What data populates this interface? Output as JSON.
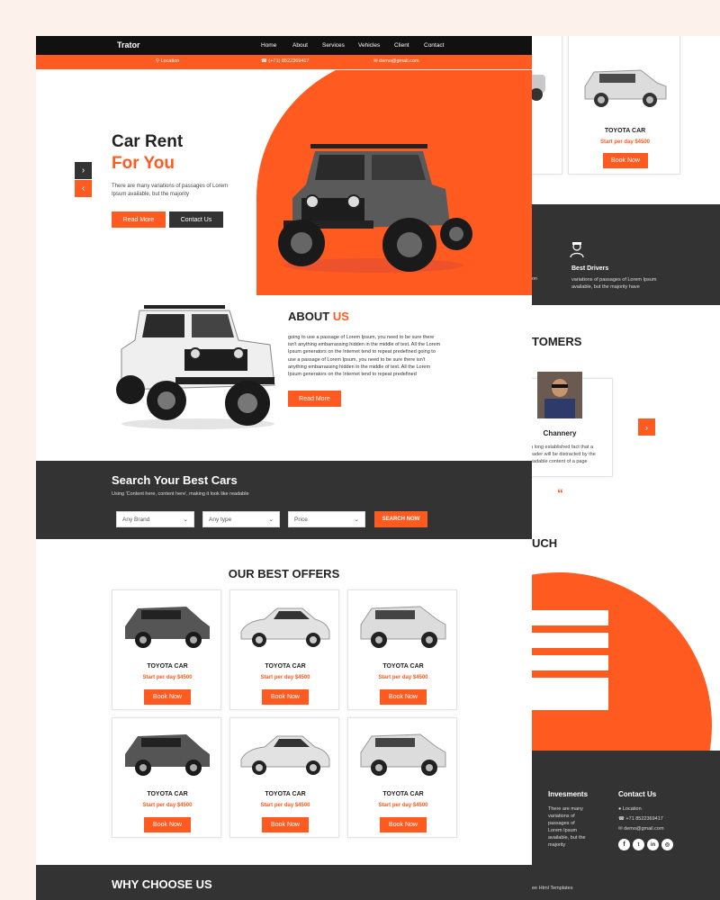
{
  "brand": "Trator",
  "nav": [
    "Home",
    "About",
    "Services",
    "Vehicles",
    "Client",
    "Contact"
  ],
  "topbar": {
    "location": "Location",
    "phone": "(+71) 8522369417",
    "email": "demo@gmail.com"
  },
  "hero": {
    "title1": "Car Rent",
    "title2": "For You",
    "text": "There are many variations of passages of Lorem Ipsum available, but the majority",
    "read_more": "Read More",
    "contact": "Contact Us"
  },
  "about": {
    "title1": "ABOUT",
    "title2": "US",
    "text": "going to use a passage of Lorem Ipsum, you need to be sure there isn't anything embarrassing hidden in the middle of text. All the Lorem Ipsum generators on the Internet tend to repeat predefined going to use a passage of Lorem Ipsum, you need to be sure there isn't anything embarrassing hidden in the middle of text. All the Lorem Ipsum generators on the Internet tend to repeat predefined",
    "read_more": "Read More"
  },
  "search": {
    "title": "Search Your Best Cars",
    "subtitle": "Using 'Content here, content here', making it look like readable",
    "brand": "Any Brand",
    "type": "Any type",
    "price": "Price",
    "button": "SEARCH NOW"
  },
  "offers": {
    "title": "OUR BEST OFFERS",
    "items": [
      {
        "name": "TOYOTA CAR",
        "price": "Start per day $4500",
        "button": "Book Now"
      },
      {
        "name": "TOYOTA CAR",
        "price": "Start per day $4500",
        "button": "Book Now"
      },
      {
        "name": "TOYOTA CAR",
        "price": "Start per day $4500",
        "button": "Book Now"
      },
      {
        "name": "TOYOTA CAR",
        "price": "Start per day $4500",
        "button": "Book Now"
      },
      {
        "name": "TOYOTA CAR",
        "price": "Start per day $4500",
        "button": "Book Now"
      },
      {
        "name": "TOYOTA CAR",
        "price": "Start per day $4500",
        "button": "Book Now"
      }
    ]
  },
  "why": {
    "title": "WHY CHOOSE US"
  },
  "back": {
    "car": {
      "name": "TOYOTA CAR",
      "price": "Start per day $4500",
      "button": "Book Now"
    },
    "drivers_title": "Best Drivers",
    "drivers_text": "variations of passages of Lorem Ipsum available, but the majority have",
    "customers_title": "TOMERS",
    "customer_name": "Channery",
    "customer_text": "a long established fact that a eader will be distracted by the eadable content of a page",
    "touch_title": "UCH",
    "invest_title": "Invesments",
    "invest_text": "There are many variations of passages of Lorem Ipsum available, but the majority",
    "contact_title": "Contact Us",
    "contact_location": "Location",
    "contact_phone": "+71 8522369417",
    "contact_email": "demo@gmail.com",
    "footer": "ee Html Templates"
  },
  "colors": {
    "accent": "#ff5a1f",
    "dark": "#333333",
    "nav": "#111111"
  }
}
